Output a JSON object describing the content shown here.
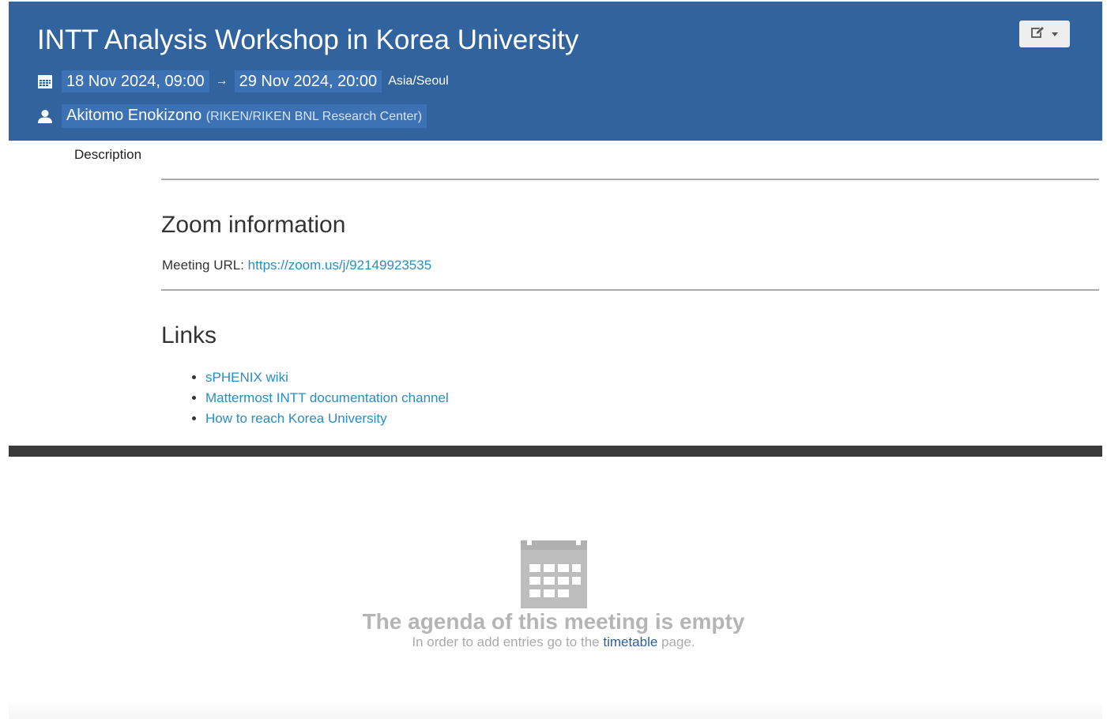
{
  "event": {
    "title": "INTT Analysis Workshop in Korea University",
    "start": "18 Nov 2024, 09:00",
    "arrow": "→",
    "end": "29 Nov 2024, 20:00",
    "timezone": "Asia/Seoul",
    "chair_name": "Akitomo Enokizono",
    "chair_affiliation": "(RIKEN/RIKEN BNL Research Center)"
  },
  "description": {
    "label": "Description",
    "zoom_heading": "Zoom information",
    "meeting_url_label": "Meeting URL: ",
    "meeting_url": "https://zoom.us/j/92149923535",
    "links_heading": "Links",
    "links": [
      "sPHENIX wiki",
      "Mattermost INTT documentation channel",
      "How to reach Korea University"
    ]
  },
  "agenda": {
    "empty_title": "The agenda of this meeting is empty",
    "hint_prefix": "In order to add entries go to the ",
    "hint_link": "timetable",
    "hint_suffix": " page."
  },
  "icons": {
    "calendar": "calendar-icon",
    "user": "user-icon",
    "edit": "edit-icon",
    "caret": "caret-down-icon"
  },
  "colors": {
    "header_bg": "#31639f",
    "pill_bg": "#3c72b3",
    "link": "#2b8cc4",
    "timetable_link": "#2a5d9a",
    "dark_bar": "#3a3a3a",
    "empty_gray": "#b5b5b5"
  }
}
